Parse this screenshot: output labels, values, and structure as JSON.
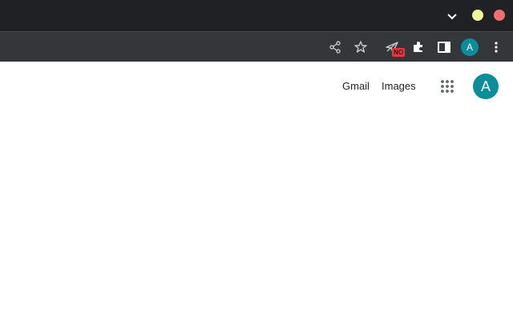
{
  "browser": {
    "ext_badge": "NO",
    "profile_initial": "A",
    "icons": [
      "chevron-down-icon",
      "share-icon",
      "star-icon",
      "extension-icon",
      "puzzle-icon",
      "side-panel-icon",
      "more-vert-icon"
    ],
    "colors": {
      "title_bar": "#202124",
      "toolbar": "#35363a",
      "minimize": "#f3f59a",
      "close": "#f26d6d",
      "avatar": "#0a8f9a",
      "badge": "#e53935"
    }
  },
  "page": {
    "gmail_link": "Gmail",
    "images_link": "Images",
    "profile_initial": "A"
  }
}
